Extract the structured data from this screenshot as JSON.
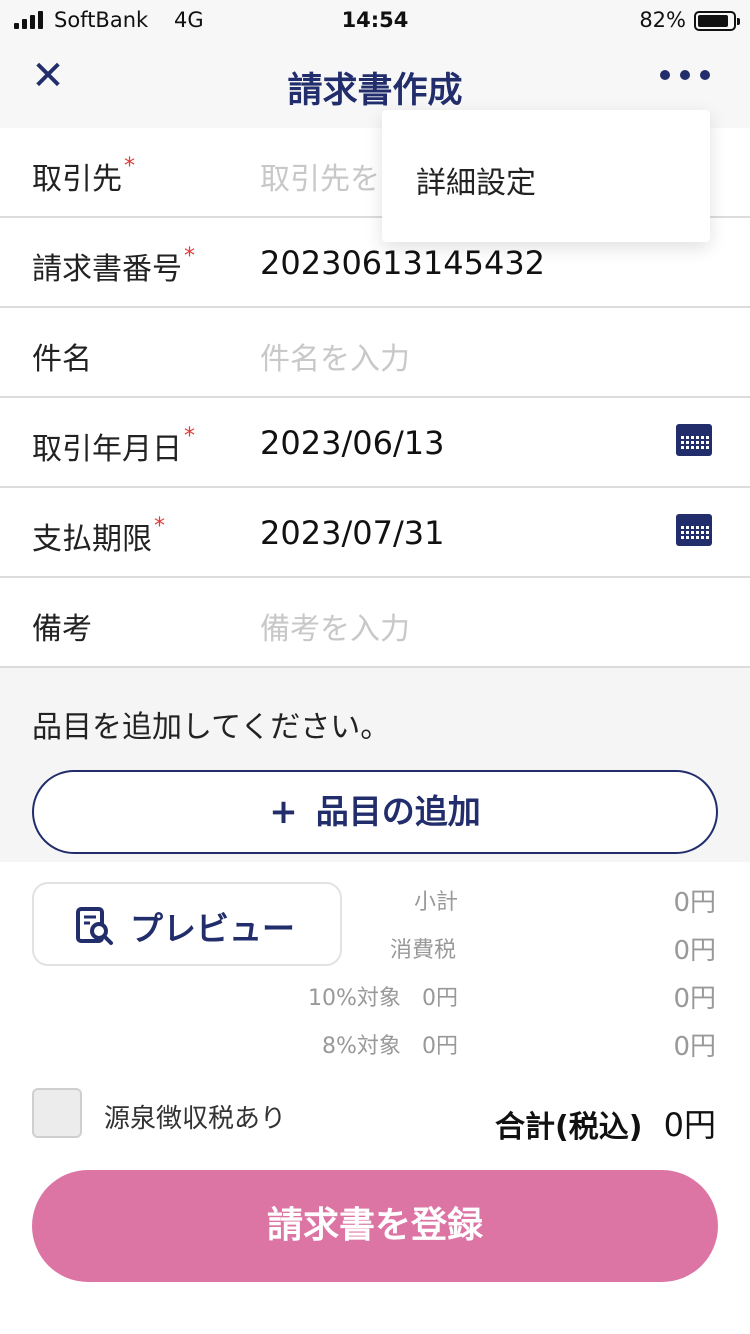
{
  "status_bar": {
    "carrier": "SoftBank",
    "network": "4G",
    "time": "14:54",
    "battery_percent": "82%"
  },
  "nav": {
    "close_icon": "close-icon",
    "title": "請求書作成",
    "more_icon": "more-dots-icon"
  },
  "menu": {
    "items": [
      {
        "label": "詳細設定"
      }
    ]
  },
  "form": {
    "client": {
      "label": "取引先",
      "required": "*",
      "placeholder": "取引先を"
    },
    "invoice_number": {
      "label": "請求書番号",
      "required": "*",
      "value": "20230613145432"
    },
    "subject": {
      "label": "件名",
      "placeholder": "件名を入力"
    },
    "transaction_date": {
      "label": "取引年月日",
      "required": "*",
      "value": "2023/06/13",
      "icon": "calendar-icon"
    },
    "due_date": {
      "label": "支払期限",
      "required": "*",
      "value": "2023/07/31",
      "icon": "calendar-icon"
    },
    "notes": {
      "label": "備考",
      "placeholder": "備考を入力"
    }
  },
  "items": {
    "hint": "品目を追加してください。",
    "add_button_plus": "+",
    "add_button_label": "品目の追加"
  },
  "summary": {
    "preview_label": "プレビュー",
    "subtotal_label": "小計",
    "subtotal_value": "0円",
    "tax_label": "消費税",
    "tax_value": "0円",
    "tax10_label": "10%対象",
    "tax10_inline": "0円",
    "tax10_value": "0円",
    "tax8_label": "8%対象",
    "tax8_inline": "0円",
    "tax8_value": "0円",
    "withholding_label": "源泉徴収税あり",
    "withholding_checked": false,
    "total_label": "合計(税込)",
    "total_value": "0円",
    "register_label": "請求書を登録"
  },
  "colors": {
    "primary": "#222d6b",
    "accent": "#dd75a4",
    "required": "#e03a3a",
    "placeholder": "#c8c8c8"
  }
}
